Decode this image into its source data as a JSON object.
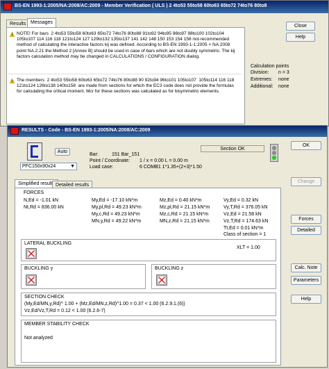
{
  "top_window": {
    "title": "BS-EN 1993-1:2005/NA:2008/AC:2009 - Member Verification ( ULS ) 2 4to53 55to58 60to63 65to72 74to76 80to8",
    "tabs": [
      "Results",
      "Messages"
    ],
    "messages": [
      "NOTE! For bars  2 4to53 55to58 60to63 65to72 74to76 80to88 91to92 94to95 96to97 98to100 102to104 105to107 114 116 118 121to124 127 129to132 135to137 141 142 148 150 153 154 156 not-recommended method of calculating the interactive factors kij was defined. According to BS-EN 1993-1-1:2005 + NA:2008 point NA.2.21 the Method 2 [Annex B] should be used in case of bars which are not doubly symmetric. The kij factors calculation method may be changed in CALCULATIONS / CONFIGURATION dialog.",
      "The members  2 4to53 55to58 60to63 65to72 74to76 80to88 90 92to94 96to101 105to107  105to114 116 118 121to124 126to138 140to158  are made from sections for which the EC3 code does not provide the formulas for calculating the critical moment. Mcr for these sections was calculated as for bisymmetric elements."
    ],
    "close_label": "Close",
    "help_label": "Help",
    "calc_points": {
      "title": "Calculation points",
      "division_label": "Division:",
      "division_value": "n = 3",
      "extremes_label": "Extremes:",
      "extremes_value": "none",
      "additional_label": "Additional:",
      "additional_value": "none"
    }
  },
  "results_window": {
    "title": "RESULTS - Code - BS-EN 1993-1:2005/NA:2008/AC:2009",
    "auto_label": "Auto",
    "section_name": "PFC150x90x24",
    "bar_label": "Bar:",
    "bar_value": "151  Bar_151",
    "point_label": "Point / Coordinate:",
    "point_value": "1 / x = 0.00 L = 0.00 m",
    "load_label": "Load case:",
    "load_value": "6 COMB1  1*1.35+(2+3)*1.50",
    "section_ok": "Section OK",
    "tabs": [
      "Simplified results",
      "Detailed results"
    ],
    "forces_title": "FORCES",
    "forces": {
      "nt_ed": "N,Ed = -1.01 kN",
      "nt_rd": "Nt,Rd = 836.00 kN",
      "my_ed": "My,Ed = -17.10 kN*m",
      "my_pl": "My,pl,Rd = 49.23 kN*m",
      "my_c": "My,c,Rd = 49.23 kN*m",
      "mn_y": "MN,y,Rd = 49.22 kN*m",
      "mz_ed": "Mz,Ed = 0.40 kN*m",
      "mz_pl": "Mz,pl,Rd = 21.15 kN*m",
      "mz_c": "Mz,c,Rd = 21.15 kN*m",
      "mn_z": "MN,z,Rd = 21.15 kN*m",
      "vy_ed": "Vy,Ed = 0.32 kN",
      "vy_t": "Vy,T,Rd = 376.05 kN",
      "vz_ed": "Vz,Ed = 21.58 kN",
      "vz_t": "Vz,T,Rd = 174.63 kN",
      "tt_ed": "Tt,Ed = 0.01 kN*m",
      "class": "Class of section = 1"
    },
    "lateral_title": "LATERAL BUCKLING",
    "xlt": "XLT = 1.00",
    "buckling_y": "BUCKLING y",
    "buckling_z": "BUCKLING z",
    "section_check_title": "SECTION CHECK",
    "check_line1": "(My,Ed/MN,y,Rd)^ 1.00 + (Mz,Ed/MN,z,Rd)^1.00 = 0.37 < 1.00   (6.2.9.1.(6))",
    "check_line2": "Vz,Ed/Vz,T,Rd = 0.12 < 1.00   (6.2.6-7)",
    "member_title": "MEMBER STABILITY CHECK",
    "member_value": "Not analyzed",
    "ok_label": "OK",
    "change_label": "Change",
    "forces_btn": "Forces",
    "detailed_btn": "Detailed",
    "calc_note_btn": "Calc. Note",
    "parameters_btn": "Parameters",
    "help_btn": "Help"
  }
}
